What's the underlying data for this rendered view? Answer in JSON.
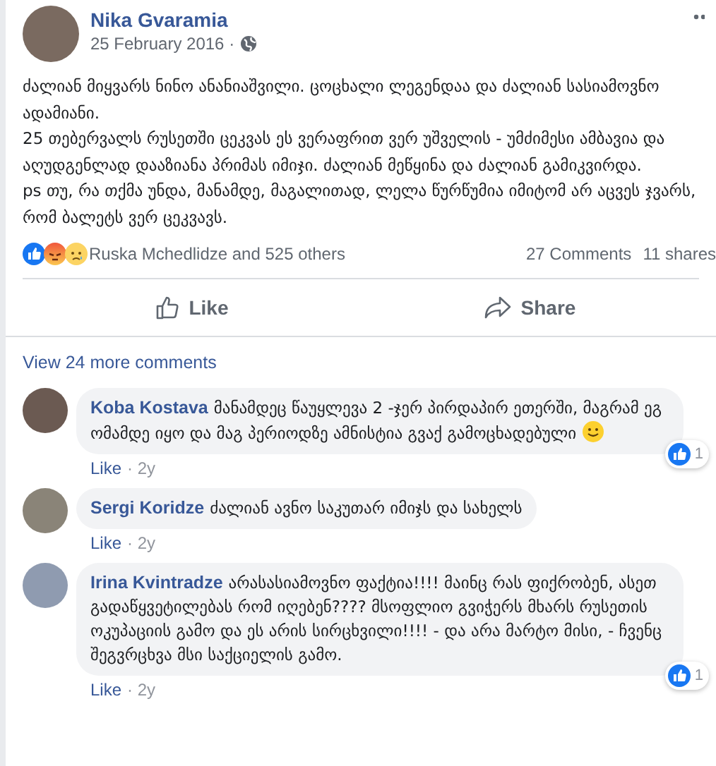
{
  "post": {
    "author": "Nika Gvaramia",
    "date": "25 February 2016 ·",
    "paragraphs": [
      "ძალიან მიყვარს ნინო ანანიაშვილი. ცოცხალი ლეგენდაა და ძალიან სასიამოვნო ადამიანი.",
      "25 თებერვალს რუსეთში ცეკვას ეს ვერაფრით ვერ უშველის - უმძიმესი ამბავია და აღუდგენლად დააზიანა პრიმას იმიჯი. ძალიან მეწყინა და ძალიან გამიკვირდა.",
      "ps თუ, რა თქმა უნდა, მანამდე, მაგალითად, ლელა წურწუმია იმიტომ არ აცვეს ჯვარს, რომ ბალეტს ვერ ცეკვავს."
    ],
    "reactions": [
      {
        "kind": "like"
      },
      {
        "kind": "angry"
      },
      {
        "kind": "sad"
      }
    ],
    "reaction_summary": "Ruska Mchedlidze and 525 others",
    "comments_count": "27 Comments",
    "shares_count": "11 shares",
    "actions": [
      {
        "kind": "like",
        "label": "Like"
      },
      {
        "kind": "share",
        "label": "Share"
      }
    ]
  },
  "comments_section": {
    "view_more": "View 24 more comments",
    "comments": [
      {
        "author": "Koba Kostava",
        "text": "მანამდეც წაუყლევა 2 -ჯერ პირდაპირ ეთერში, მაგრამ ეგ ომამდე იყო და მაგ პერიოდზე ამნისტია გვაქ გამოცხადებული",
        "smiley_emoji": true,
        "reaction_count": "1",
        "like_label": "Like",
        "age": "· 2y"
      },
      {
        "author": "Sergi Koridze",
        "text": "ძალიან ავნო საკუთარ იმიჯს და სახელს",
        "like_label": "Like",
        "age": "· 2y"
      },
      {
        "author": "Irina Kvintradze",
        "text": "არასასიამოვნო ფაქტია!!!! მაინც რას ფიქრობენ, ასეთ გადაწყვეტილებას რომ იღებენ???? მსოფლიო გვიჭერს მხარს რუსეთის ოკუპაციის გამო და ეს არის სირცხვილი!!!! - და არა მარტო მისი, - ჩვენც შეგვრცხვა მსი საქციელის გამო.",
        "reaction_count": "1",
        "like_label": "Like",
        "age": "· 2y"
      }
    ]
  }
}
